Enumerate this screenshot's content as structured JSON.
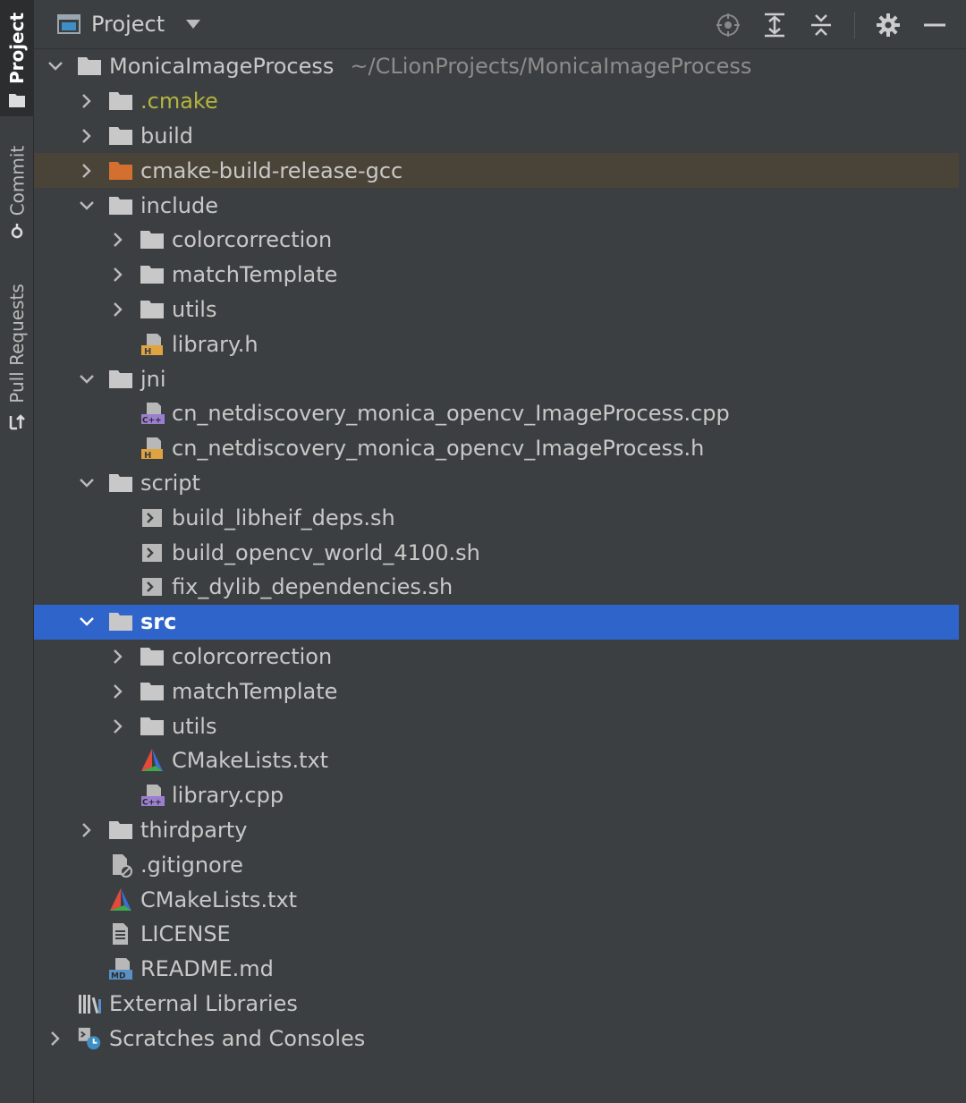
{
  "toolstrip": {
    "tabs": [
      {
        "label": "Project",
        "icon": "folder-icon",
        "active": true
      },
      {
        "label": "Commit",
        "icon": "commit-icon",
        "active": false
      },
      {
        "label": "Pull Requests",
        "icon": "pull-request-icon",
        "active": false
      }
    ]
  },
  "header": {
    "title": "Project",
    "tools": [
      "locate-icon",
      "expand-all-icon",
      "collapse-all-icon",
      "gear-icon",
      "minimize-icon"
    ]
  },
  "colors": {
    "background": "#3c3f41",
    "selection": "#2f65ca",
    "excluded_highlight": "#4a4337",
    "folder": "#c8c8c8",
    "excluded_folder": "#d4702f",
    "header_file": "#e0a340",
    "cpp_file": "#9b7fcf"
  },
  "tree": [
    {
      "label": "MonicaImageProcess",
      "path": "~/CLionProjects/MonicaImageProcess",
      "level": 0,
      "chevron": "down",
      "icon": "folder-icon"
    },
    {
      "label": ".cmake",
      "level": 1,
      "chevron": "right",
      "icon": "folder-icon",
      "style": "yellow"
    },
    {
      "label": "build",
      "level": 1,
      "chevron": "right",
      "icon": "folder-icon"
    },
    {
      "label": "cmake-build-release-gcc",
      "level": 1,
      "chevron": "right",
      "icon": "excluded-folder-icon",
      "state": "highlight"
    },
    {
      "label": "include",
      "level": 1,
      "chevron": "down",
      "icon": "folder-icon"
    },
    {
      "label": "colorcorrection",
      "level": 2,
      "chevron": "right",
      "icon": "folder-icon"
    },
    {
      "label": "matchTemplate",
      "level": 2,
      "chevron": "right",
      "icon": "folder-icon"
    },
    {
      "label": "utils",
      "level": 2,
      "chevron": "right",
      "icon": "folder-icon"
    },
    {
      "label": "library.h",
      "level": 2,
      "chevron": "none",
      "icon": "header-file-icon"
    },
    {
      "label": "jni",
      "level": 1,
      "chevron": "down",
      "icon": "folder-icon"
    },
    {
      "label": "cn_netdiscovery_monica_opencv_ImageProcess.cpp",
      "level": 2,
      "chevron": "none",
      "icon": "cpp-file-icon"
    },
    {
      "label": "cn_netdiscovery_monica_opencv_ImageProcess.h",
      "level": 2,
      "chevron": "none",
      "icon": "header-file-icon"
    },
    {
      "label": "script",
      "level": 1,
      "chevron": "down",
      "icon": "folder-icon"
    },
    {
      "label": "build_libheif_deps.sh",
      "level": 2,
      "chevron": "none",
      "icon": "shell-script-icon"
    },
    {
      "label": "build_opencv_world_4100.sh",
      "level": 2,
      "chevron": "none",
      "icon": "shell-script-icon"
    },
    {
      "label": "fix_dylib_dependencies.sh",
      "level": 2,
      "chevron": "none",
      "icon": "shell-script-icon"
    },
    {
      "label": "src",
      "level": 1,
      "chevron": "down",
      "icon": "folder-icon",
      "state": "selected"
    },
    {
      "label": "colorcorrection",
      "level": 2,
      "chevron": "right",
      "icon": "folder-icon"
    },
    {
      "label": "matchTemplate",
      "level": 2,
      "chevron": "right",
      "icon": "folder-icon"
    },
    {
      "label": "utils",
      "level": 2,
      "chevron": "right",
      "icon": "folder-icon"
    },
    {
      "label": "CMakeLists.txt",
      "level": 2,
      "chevron": "none",
      "icon": "cmake-icon"
    },
    {
      "label": "library.cpp",
      "level": 2,
      "chevron": "none",
      "icon": "cpp-file-icon"
    },
    {
      "label": "thirdparty",
      "level": 1,
      "chevron": "right",
      "icon": "folder-icon"
    },
    {
      "label": ".gitignore",
      "level": 1,
      "chevron": "none",
      "icon": "ignored-file-icon"
    },
    {
      "label": "CMakeLists.txt",
      "level": 1,
      "chevron": "none",
      "icon": "cmake-icon"
    },
    {
      "label": "LICENSE",
      "level": 1,
      "chevron": "none",
      "icon": "text-file-icon"
    },
    {
      "label": "README.md",
      "level": 1,
      "chevron": "none",
      "icon": "markdown-file-icon"
    },
    {
      "label": "External Libraries",
      "level": 0,
      "chevron": "none",
      "icon": "libraries-icon"
    },
    {
      "label": "Scratches and Consoles",
      "level": 0,
      "chevron": "right",
      "icon": "scratches-icon"
    }
  ]
}
